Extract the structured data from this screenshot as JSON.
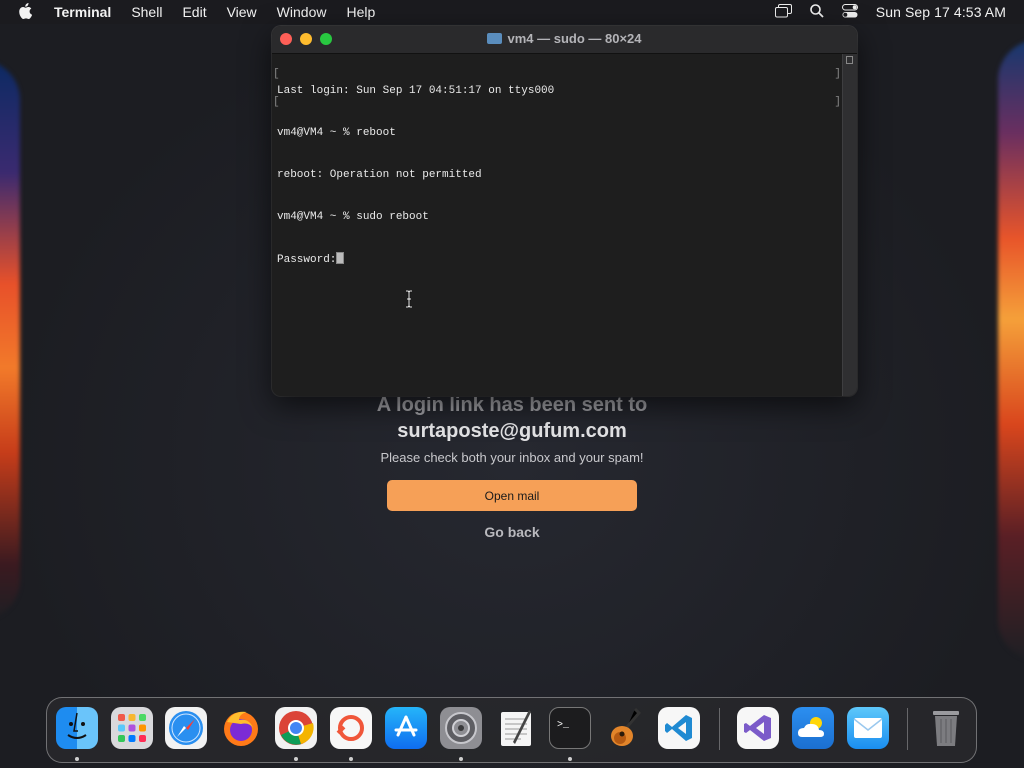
{
  "menubar": {
    "app_name": "Terminal",
    "menus": [
      "Shell",
      "Edit",
      "View",
      "Window",
      "Help"
    ],
    "clock": "Sun Sep 17  4:53 AM"
  },
  "terminal": {
    "title": "vm4 — sudo — 80×24",
    "lines": [
      "Last login: Sun Sep 17 04:51:17 on ttys000",
      "vm4@VM4 ~ % reboot",
      "reboot: Operation not permitted",
      "vm4@VM4 ~ % sudo reboot",
      "Password:"
    ]
  },
  "login_page": {
    "line1": "A login link has been sent to",
    "email": "surtaposte@gufum.com",
    "hint": "Please check both your inbox and your spam!",
    "open_mail_label": "Open mail",
    "go_back_label": "Go back"
  },
  "dock": {
    "apps": [
      "finder",
      "launchpad",
      "safari",
      "firefox",
      "chrome",
      "app",
      "app-store",
      "system-settings",
      "textedit",
      "terminal",
      "garageband",
      "vscode",
      "visual-studio",
      "weather",
      "mail",
      "trash"
    ]
  }
}
